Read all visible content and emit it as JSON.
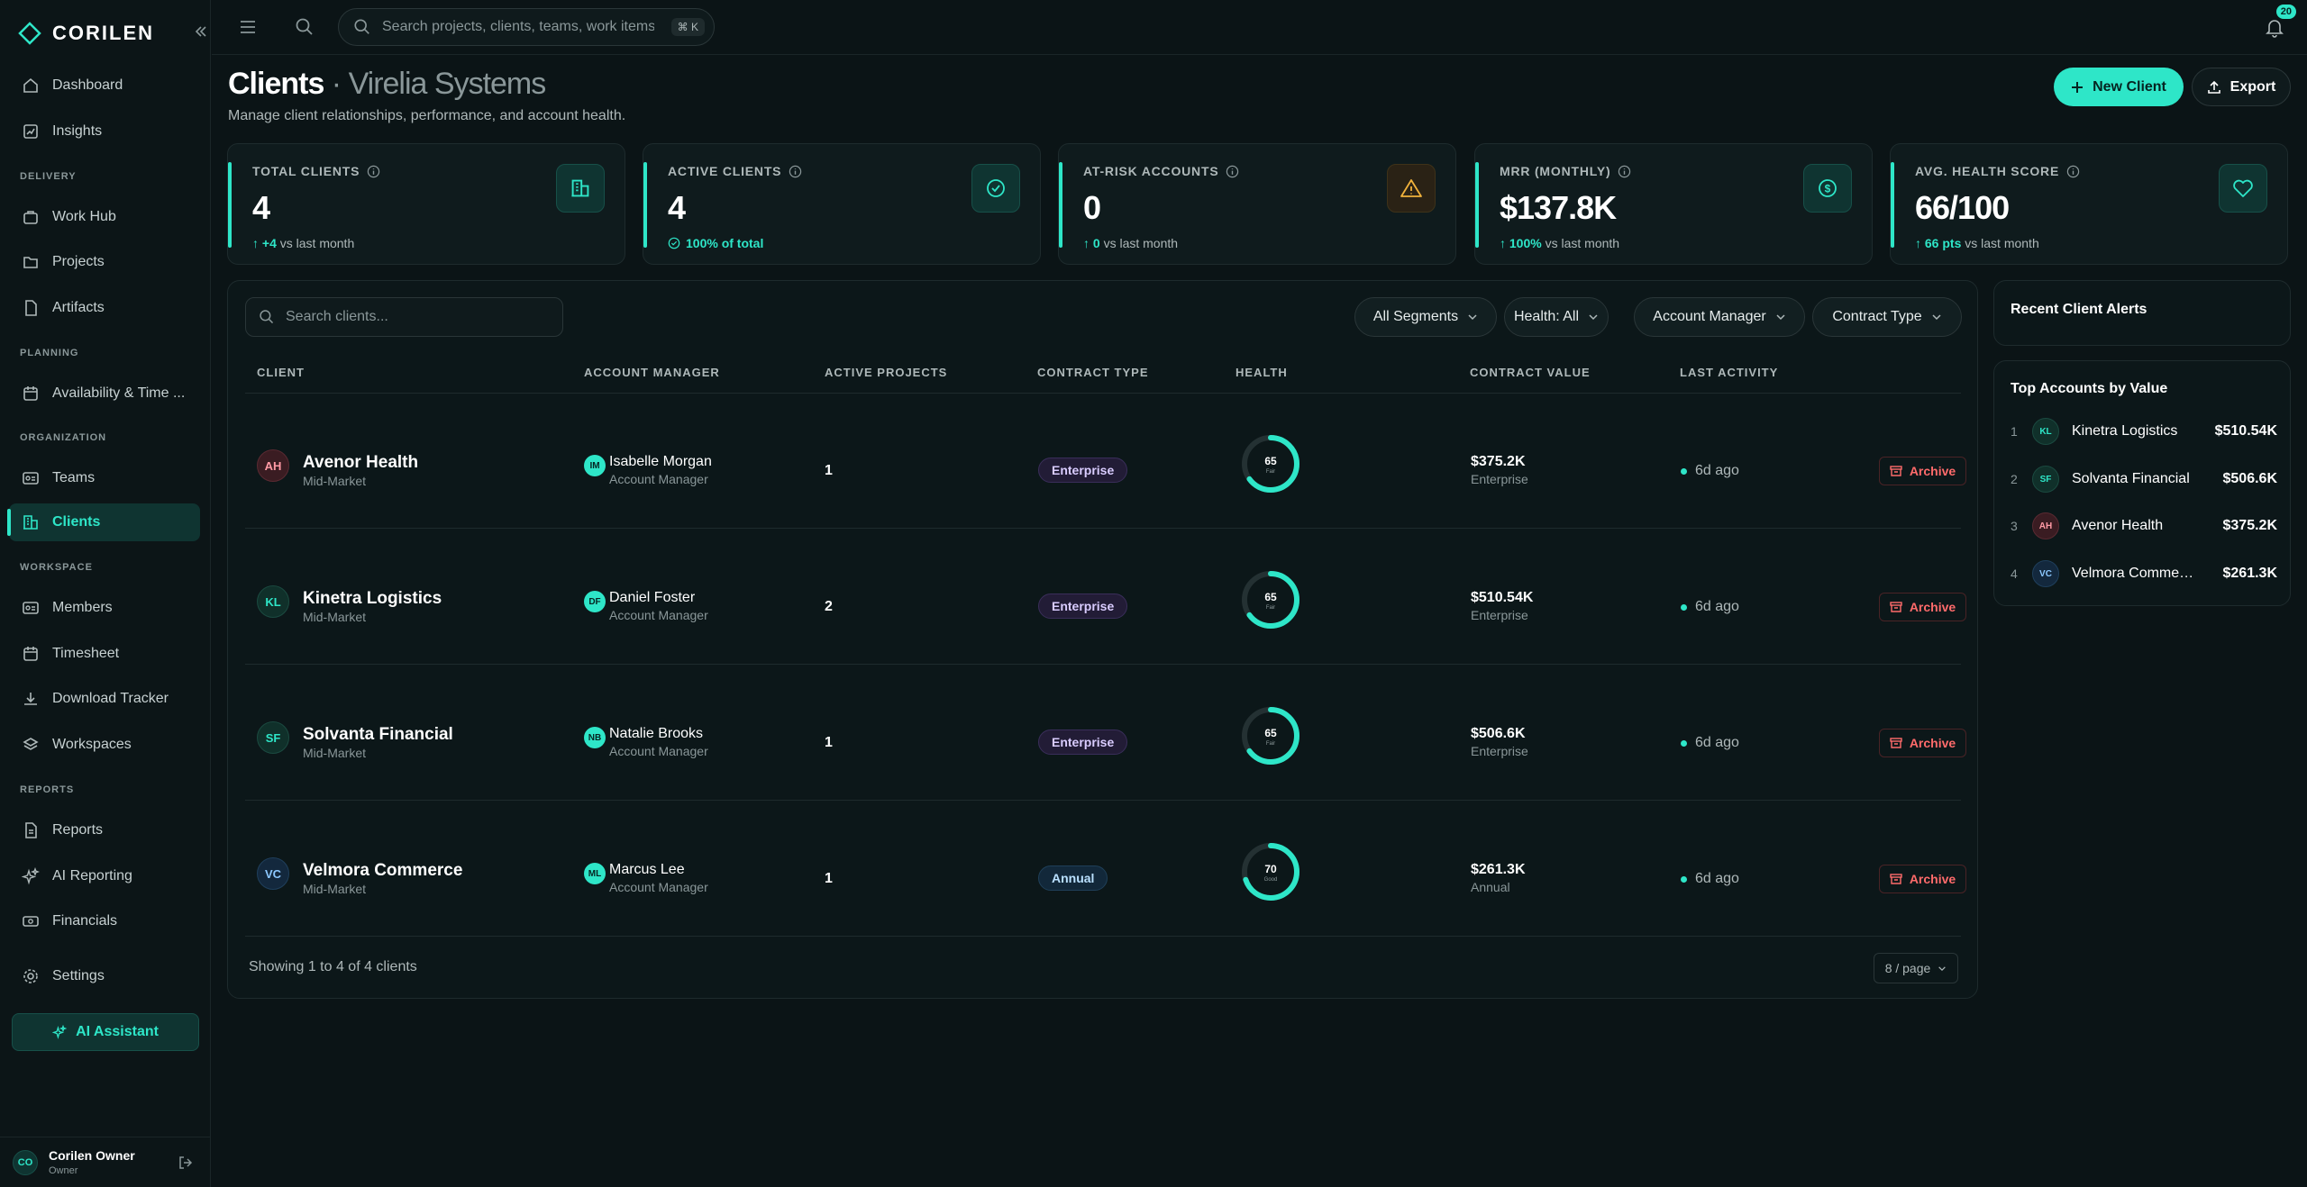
{
  "brand": {
    "name": "CORILEN"
  },
  "sidebar": {
    "items": [
      {
        "label": "Dashboard"
      },
      {
        "label": "Insights"
      },
      {
        "label": "Work Hub"
      },
      {
        "label": "Projects"
      },
      {
        "label": "Artifacts"
      },
      {
        "label": "Availability & Time ..."
      },
      {
        "label": "Teams"
      },
      {
        "label": "Clients"
      },
      {
        "label": "Members"
      },
      {
        "label": "Timesheet"
      },
      {
        "label": "Download Tracker"
      },
      {
        "label": "Workspaces"
      },
      {
        "label": "Reports"
      },
      {
        "label": "AI Reporting"
      },
      {
        "label": "Financials"
      },
      {
        "label": "Settings"
      }
    ],
    "sections": [
      "DELIVERY",
      "PLANNING",
      "ORGANIZATION",
      "WORKSPACE",
      "REPORTS"
    ],
    "ai_assistant": "AI Assistant",
    "user": {
      "initials": "CO",
      "name": "Corilen Owner",
      "role": "Owner"
    }
  },
  "topbar": {
    "search_placeholder": "Search projects, clients, teams, work items...",
    "shortcut": "⌘ K",
    "notifications": "20"
  },
  "header": {
    "title": "Clients",
    "separator": " · ",
    "org": "Virelia Systems",
    "subtitle": "Manage client relationships, performance, and account health.",
    "new_client": "New Client",
    "export": "Export"
  },
  "stats": [
    {
      "label": "TOTAL CLIENTS",
      "value": "4",
      "delta": "+4",
      "delta_text": "vs last month",
      "icon": "building-icon"
    },
    {
      "label": "ACTIVE CLIENTS",
      "value": "4",
      "delta": "100% of total",
      "delta_text": "",
      "icon": "check-circle-icon"
    },
    {
      "label": "AT-RISK ACCOUNTS",
      "value": "0",
      "delta": "0",
      "delta_text": "vs last month",
      "icon": "warning-icon"
    },
    {
      "label": "MRR (MONTHLY)",
      "value": "$137.8K",
      "delta": "100%",
      "delta_text": "vs last month",
      "icon": "dollar-icon"
    },
    {
      "label": "AVG. HEALTH SCORE",
      "value": "66/100",
      "delta": "66 pts",
      "delta_text": "vs last month",
      "icon": "heart-icon"
    }
  ],
  "table": {
    "search_placeholder": "Search clients...",
    "filters": [
      "All Segments",
      "Health: All",
      "Account Manager",
      "Contract Type"
    ],
    "columns": [
      "CLIENT",
      "ACCOUNT MANAGER",
      "ACTIVE PROJECTS",
      "CONTRACT TYPE",
      "HEALTH",
      "CONTRACT VALUE",
      "LAST ACTIVITY"
    ],
    "rows": [
      {
        "initials": "AH",
        "name": "Avenor Health",
        "segment": "Mid-Market",
        "mgr_initials": "IM",
        "manager": "Isabelle Morgan",
        "manager_role": "Account Manager",
        "projects": "1",
        "contract": "Enterprise",
        "health": 65,
        "health_label": "Fair",
        "value": "$375.2K",
        "value_type": "Enterprise",
        "activity": "6d ago",
        "archive": "Archive"
      },
      {
        "initials": "KL",
        "name": "Kinetra Logistics",
        "segment": "Mid-Market",
        "mgr_initials": "DF",
        "manager": "Daniel Foster",
        "manager_role": "Account Manager",
        "projects": "2",
        "contract": "Enterprise",
        "health": 65,
        "health_label": "Fair",
        "value": "$510.54K",
        "value_type": "Enterprise",
        "activity": "6d ago",
        "archive": "Archive"
      },
      {
        "initials": "SF",
        "name": "Solvanta Financial",
        "segment": "Mid-Market",
        "mgr_initials": "NB",
        "manager": "Natalie Brooks",
        "manager_role": "Account Manager",
        "projects": "1",
        "contract": "Enterprise",
        "health": 65,
        "health_label": "Fair",
        "value": "$506.6K",
        "value_type": "Enterprise",
        "activity": "6d ago",
        "archive": "Archive"
      },
      {
        "initials": "VC",
        "name": "Velmora Commerce",
        "segment": "Mid-Market",
        "mgr_initials": "ML",
        "manager": "Marcus Lee",
        "manager_role": "Account Manager",
        "projects": "1",
        "contract": "Annual",
        "health": 70,
        "health_label": "Good",
        "value": "$261.3K",
        "value_type": "Annual",
        "activity": "6d ago",
        "archive": "Archive"
      }
    ],
    "footer": "Showing 1 to 4 of 4 clients",
    "per_page": "8 / page"
  },
  "alerts": {
    "title": "Recent Client Alerts"
  },
  "top_accounts": {
    "title": "Top Accounts by Value",
    "items": [
      {
        "rank": "1",
        "initials": "KL",
        "name": "Kinetra Logistics",
        "value": "$510.54K"
      },
      {
        "rank": "2",
        "initials": "SF",
        "name": "Solvanta Financial",
        "value": "$506.6K"
      },
      {
        "rank": "3",
        "initials": "AH",
        "name": "Avenor Health",
        "value": "$375.2K"
      },
      {
        "rank": "4",
        "initials": "VC",
        "name": "Velmora Commerce",
        "value": "$261.3K"
      }
    ]
  },
  "colors": {
    "accent": "#2ee6c8",
    "danger": "#ff6b6b",
    "warning": "#f0b23c",
    "background": "#0b1416"
  }
}
